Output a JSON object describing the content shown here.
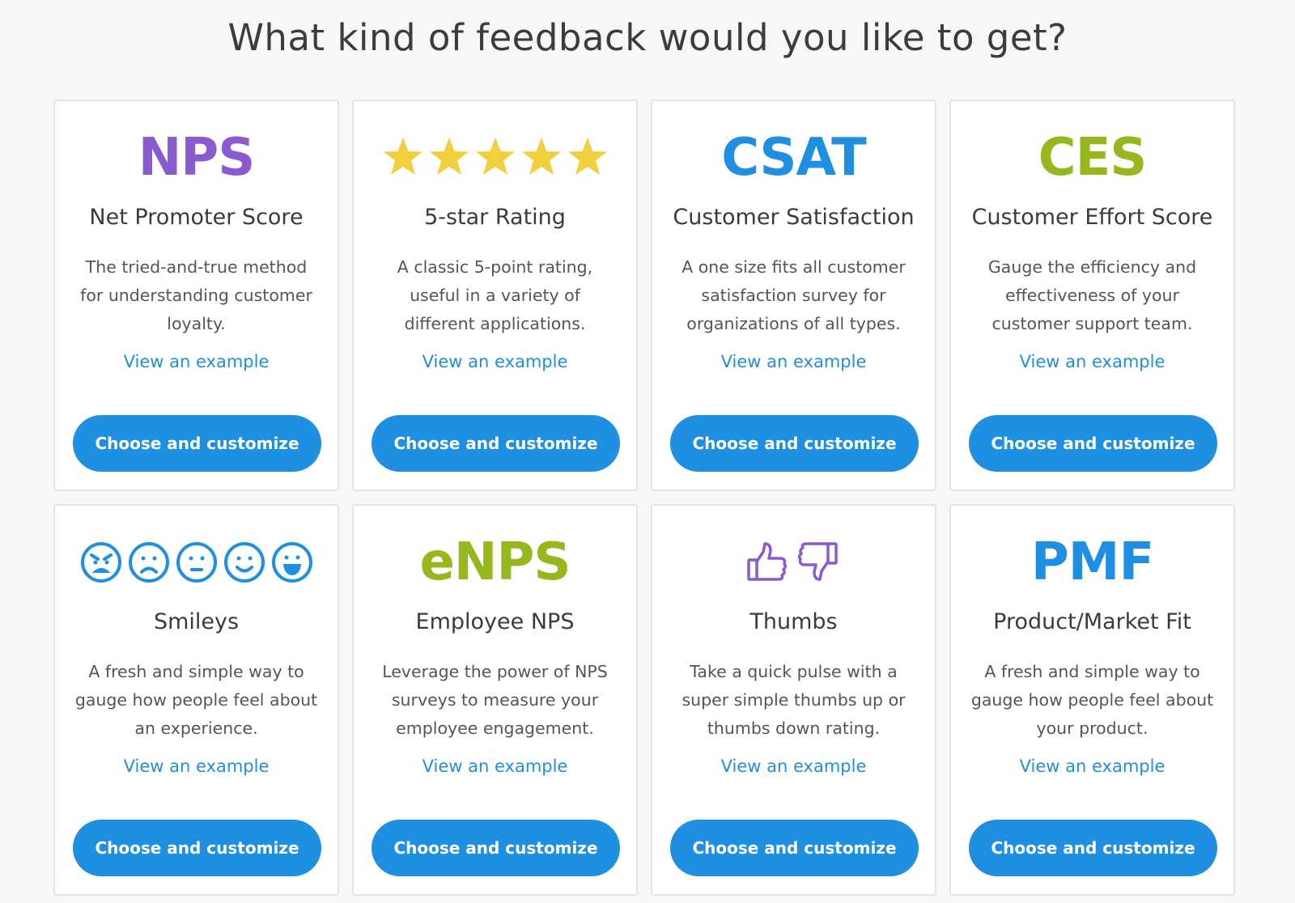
{
  "page_title": "What kind of feedback would you like to get?",
  "colors": {
    "nps_purple": "#8a5bd0",
    "star_yellow": "#f2cf3c",
    "blue": "#1f8fe1",
    "green": "#96b81c",
    "link_blue": "#1f8fde"
  },
  "cards": [
    {
      "logo_text": "NPS",
      "title": "Net Promoter Score",
      "description": "The tried-and-true method for understanding customer loyalty.",
      "link": "View an example",
      "button": "Choose and customize"
    },
    {
      "icon": "five-stars-icon",
      "title": "5-star Rating",
      "description": "A classic 5-point rating, useful in a variety of different applications.",
      "link": "View an example",
      "button": "Choose and customize"
    },
    {
      "logo_text": "CSAT",
      "title": "Customer Satisfaction",
      "description": "A one size fits all customer satisfaction survey for organizations of all types.",
      "link": "View an example",
      "button": "Choose and customize"
    },
    {
      "logo_text": "CES",
      "title": "Customer Effort Score",
      "description": "Gauge the efficiency and effectiveness of your customer support team.",
      "link": "View an example",
      "button": "Choose and customize"
    },
    {
      "icon": "smileys-icon",
      "title": "Smileys",
      "description": "A fresh and simple way to gauge how people feel about an experience.",
      "link": "View an example",
      "button": "Choose and customize"
    },
    {
      "logo_text": "eNPS",
      "title": "Employee NPS",
      "description": "Leverage the power of NPS surveys to measure your employee engagement.",
      "link": "View an example",
      "button": "Choose and customize"
    },
    {
      "icon": "thumbs-icon",
      "title": "Thumbs",
      "description": "Take a quick pulse with a super simple thumbs up or thumbs down rating.",
      "link": "View an example",
      "button": "Choose and customize"
    },
    {
      "logo_text": "PMF",
      "title": "Product/Market Fit",
      "description": "A fresh and simple way to gauge how people feel about your product.",
      "link": "View an example",
      "button": "Choose and customize"
    }
  ]
}
